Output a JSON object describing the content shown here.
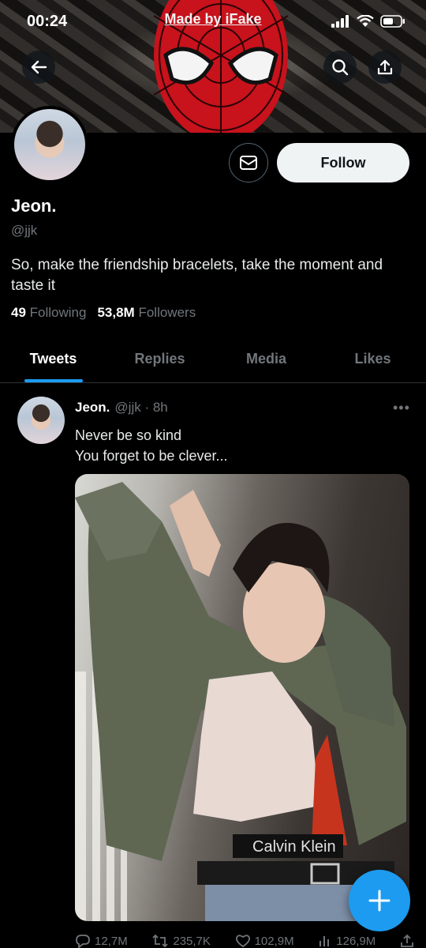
{
  "status_bar": {
    "time": "00:24",
    "watermark": "Made by iFake"
  },
  "profile": {
    "name": "Jeon.",
    "handle": "@jjk",
    "bio": "So, make the friendship bracelets, take the moment and taste it",
    "following_count": "49",
    "following_label": "Following",
    "followers_count": "53,8M",
    "followers_label": "Followers",
    "follow_label": "Follow"
  },
  "tabs": [
    {
      "label": "Tweets",
      "active": true
    },
    {
      "label": "Replies",
      "active": false
    },
    {
      "label": "Media",
      "active": false
    },
    {
      "label": "Likes",
      "active": false
    }
  ],
  "tweet": {
    "name": "Jeon.",
    "meta": "@jjk · 8h",
    "line1": "Never be so kind",
    "line2": "You forget to be clever...",
    "replies": "12,7M",
    "retweets": "235,7K",
    "likes": "102,9M",
    "views": "126,9M"
  },
  "colors": {
    "accent": "#1d9bf0",
    "background": "#000000",
    "muted": "#71767b"
  },
  "icons": [
    "back-arrow-icon",
    "search-icon",
    "share-icon",
    "mail-icon",
    "more-icon",
    "reply-icon",
    "retweet-icon",
    "like-icon",
    "views-icon",
    "compose-icon"
  ]
}
